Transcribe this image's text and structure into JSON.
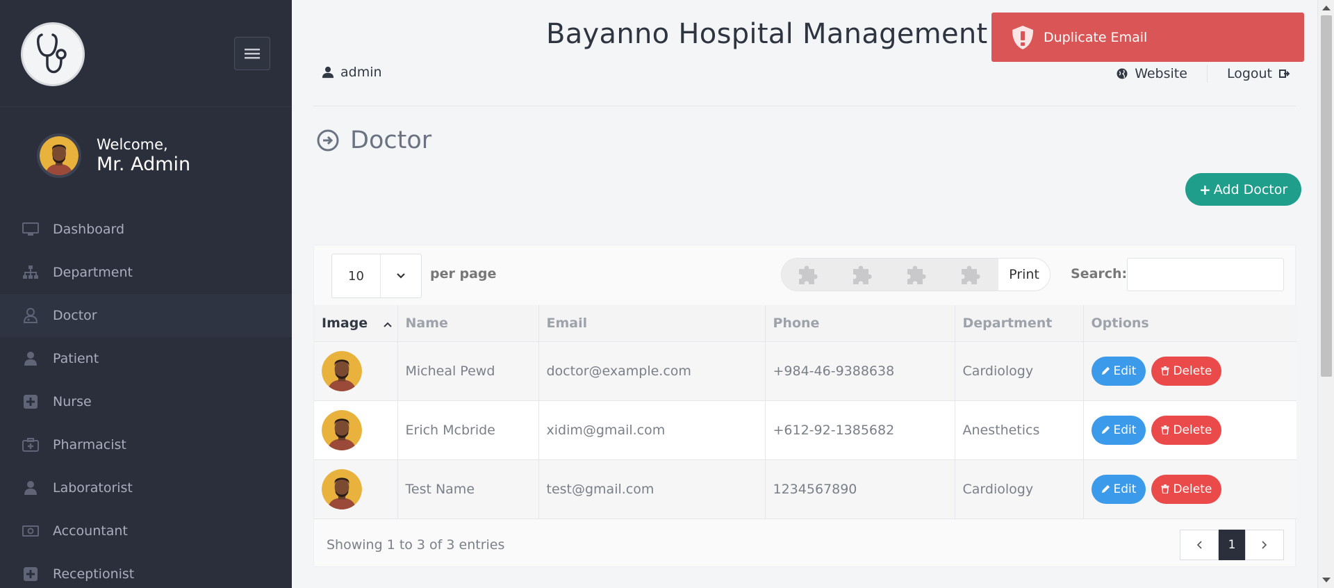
{
  "app": {
    "title": "Bayanno Hospital Management System"
  },
  "header": {
    "user": "admin",
    "website": "Website",
    "logout": "Logout"
  },
  "toast": {
    "message": "Duplicate Email"
  },
  "sidebar": {
    "welcome": "Welcome,",
    "user_name": "Mr. Admin",
    "items": [
      {
        "label": "Dashboard",
        "icon": "monitor-icon"
      },
      {
        "label": "Department",
        "icon": "sitemap-icon"
      },
      {
        "label": "Doctor",
        "icon": "user-md-icon",
        "active": true
      },
      {
        "label": "Patient",
        "icon": "user-icon"
      },
      {
        "label": "Nurse",
        "icon": "plus-square-icon"
      },
      {
        "label": "Pharmacist",
        "icon": "medkit-icon"
      },
      {
        "label": "Laboratorist",
        "icon": "user-icon"
      },
      {
        "label": "Accountant",
        "icon": "money-icon"
      },
      {
        "label": "Receptionist",
        "icon": "plus-square-icon"
      }
    ]
  },
  "page": {
    "title": "Doctor",
    "add_button": "Add Doctor"
  },
  "table_controls": {
    "per_page_value": "10",
    "per_page_label": "per page",
    "print": "Print",
    "search_label": "Search:"
  },
  "table": {
    "columns": [
      "Image",
      "Name",
      "Email",
      "Phone",
      "Department",
      "Options"
    ],
    "rows": [
      {
        "name": "Micheal Pewd",
        "email": "doctor@example.com",
        "phone": "+984-46-9388638",
        "department": "Cardiology"
      },
      {
        "name": "Erich Mcbride",
        "email": "xidim@gmail.com",
        "phone": "+612-92-1385682",
        "department": "Anesthetics"
      },
      {
        "name": "Test Name",
        "email": "test@gmail.com",
        "phone": "1234567890",
        "department": "Cardiology"
      }
    ],
    "edit_label": "Edit",
    "delete_label": "Delete",
    "info": "Showing 1 to 3 of 3 entries",
    "current_page": "1"
  },
  "colors": {
    "sidebar": "#2b2f3c",
    "accent": "#1e9e8b",
    "toast": "#da5656",
    "edit": "#3b9bea",
    "delete": "#ea4a4a"
  }
}
